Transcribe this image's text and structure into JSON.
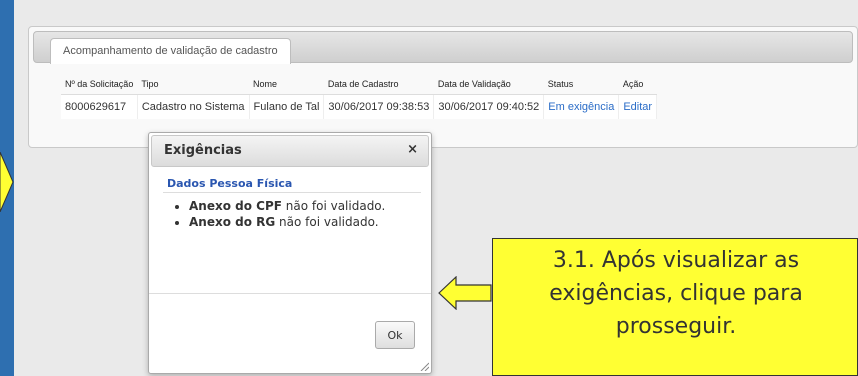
{
  "panel": {
    "tab_label": "Acompanhamento de validação de cadastro"
  },
  "table": {
    "columns": [
      "Nº da Solicitação",
      "Tipo",
      "Nome",
      "Data de Cadastro",
      "Data de Validação",
      "Status",
      "Ação"
    ],
    "rows": [
      [
        "8000629617",
        "Cadastro no Sistema",
        "Fulano de Tal",
        "30/06/2017 09:38:53",
        "30/06/2017 09:40:52",
        "Em exigência",
        "Editar"
      ]
    ]
  },
  "dialog": {
    "title": "Exigências",
    "close_symbol": "×",
    "section_title": "Dados Pessoa Física",
    "items": [
      {
        "bold": "Anexo do CPF",
        "text": " não foi validado."
      },
      {
        "bold": "Anexo do RG",
        "text": " não foi validado."
      }
    ],
    "ok_label": "Ok"
  },
  "callout": {
    "lines": [
      "3.1. Após visualizar as",
      "exigências, clique para",
      "prosseguir."
    ]
  },
  "colors": {
    "background": "#2e6fb0",
    "callout": "#ffff33",
    "link": "#2a6cc7",
    "section_title": "#2a56b0"
  },
  "icons": [
    "close-icon",
    "arrow-left-icon",
    "resize-handle-icon"
  ]
}
